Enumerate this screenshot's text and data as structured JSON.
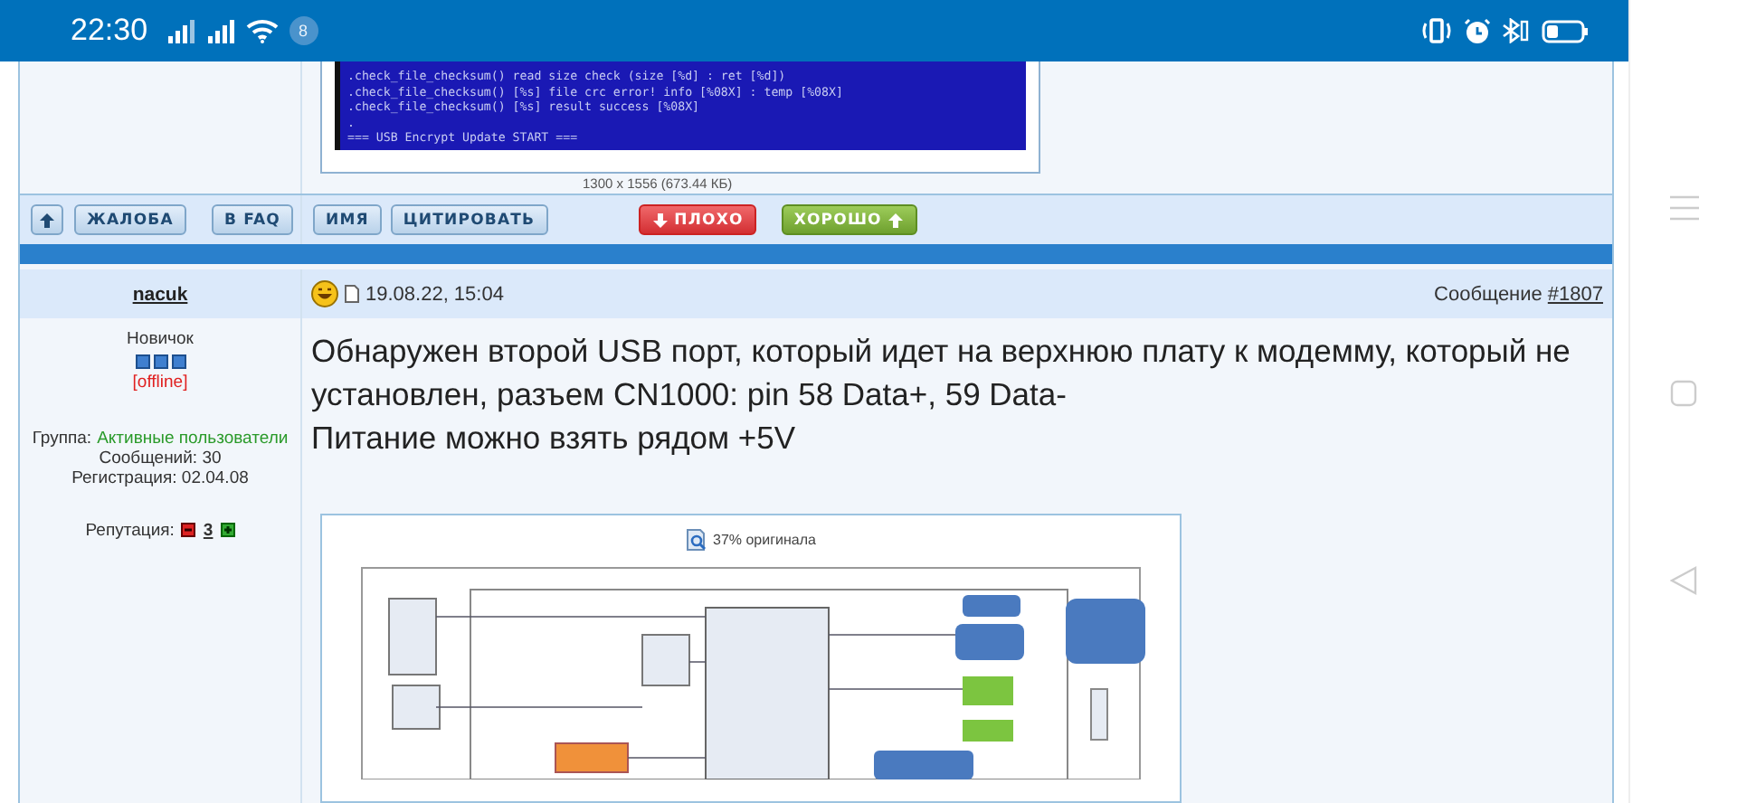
{
  "status_bar": {
    "time": "22:30",
    "notification_count": "8"
  },
  "previous_post": {
    "terminal_lines": [
      ".check_file_checksum() read size check (size [%d] : ret [%d])",
      ".check_file_checksum() [%s] file crc error! info [%08X] : temp [%08X]",
      ".check_file_checksum() [%s] result success [%08X]",
      ".",
      "=== USB Encrypt Update START ==="
    ],
    "caption": "1300 x 1556 (673.44 КБ)"
  },
  "sidebar_buttons": [
    {
      "kind": "up"
    },
    {
      "kind": "plain",
      "label": "ЖАЛОБА"
    },
    {
      "kind": "plain",
      "label": "В FAQ"
    }
  ],
  "post_buttons": [
    {
      "kind": "plain",
      "label": "ИМЯ"
    },
    {
      "kind": "plain",
      "label": "ЦИТИРОВАТЬ"
    },
    {
      "kind": "bad",
      "label": "ПЛОХО"
    },
    {
      "kind": "good",
      "label": "ХОРОШО"
    }
  ],
  "post": {
    "author": "nacuk",
    "date": "19.08.22, 15:04",
    "message_label": "Сообщение",
    "message_link": "#1807",
    "rank": "Новичок",
    "online": false,
    "status": "[offline]",
    "group_label": "Группа:",
    "group": "Активные пользователи",
    "messages": "Сообщений: 30",
    "registered": "Регистрация: 02.04.08",
    "reputation_label": "Репутация:",
    "reputation": "3",
    "text": "Обнаружен второй USB порт, который идет на верхнюю плату к модемму, который не\nустановлен, разъем CN1000: pin 58 Data+, 59 Data-\nПитание можно взять рядом +5V",
    "attachment": {
      "zoom_label": "37% оригинала",
      "kind": "picture"
    }
  }
}
